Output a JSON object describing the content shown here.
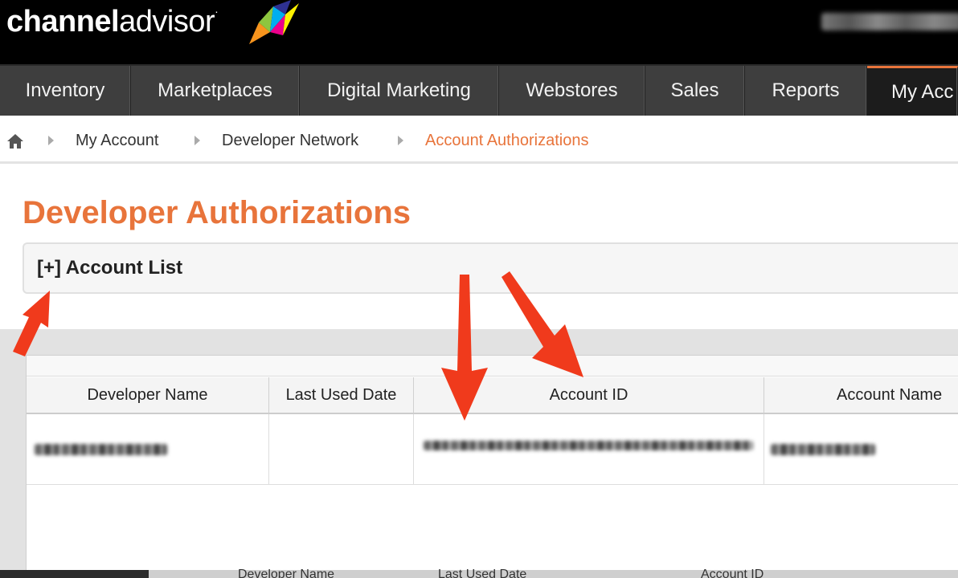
{
  "brand": {
    "name_bold": "channel",
    "name_light": "advisor",
    "trademark": "·"
  },
  "nav": {
    "items": [
      {
        "label": "Inventory"
      },
      {
        "label": "Marketplaces"
      },
      {
        "label": "Digital Marketing"
      },
      {
        "label": "Webstores"
      },
      {
        "label": "Sales"
      },
      {
        "label": "Reports"
      },
      {
        "label": "My Acc"
      }
    ]
  },
  "breadcrumb": {
    "items": [
      {
        "label": "My Account"
      },
      {
        "label": "Developer Network"
      },
      {
        "label": "Account Authorizations"
      }
    ]
  },
  "page": {
    "title": "Developer Authorizations",
    "panel_title": "[+] Account List"
  },
  "grid": {
    "columns": [
      "Developer Name",
      "Last Used Date",
      "Account ID",
      "Account Name"
    ]
  },
  "bottom_repeat": {
    "columns": [
      "Developer Name",
      "Last Used Date",
      "Account ID"
    ]
  },
  "colors": {
    "accent": "#e8743b",
    "annotation_arrow": "#f03a1c",
    "nav_bg": "#3e3e3e"
  }
}
